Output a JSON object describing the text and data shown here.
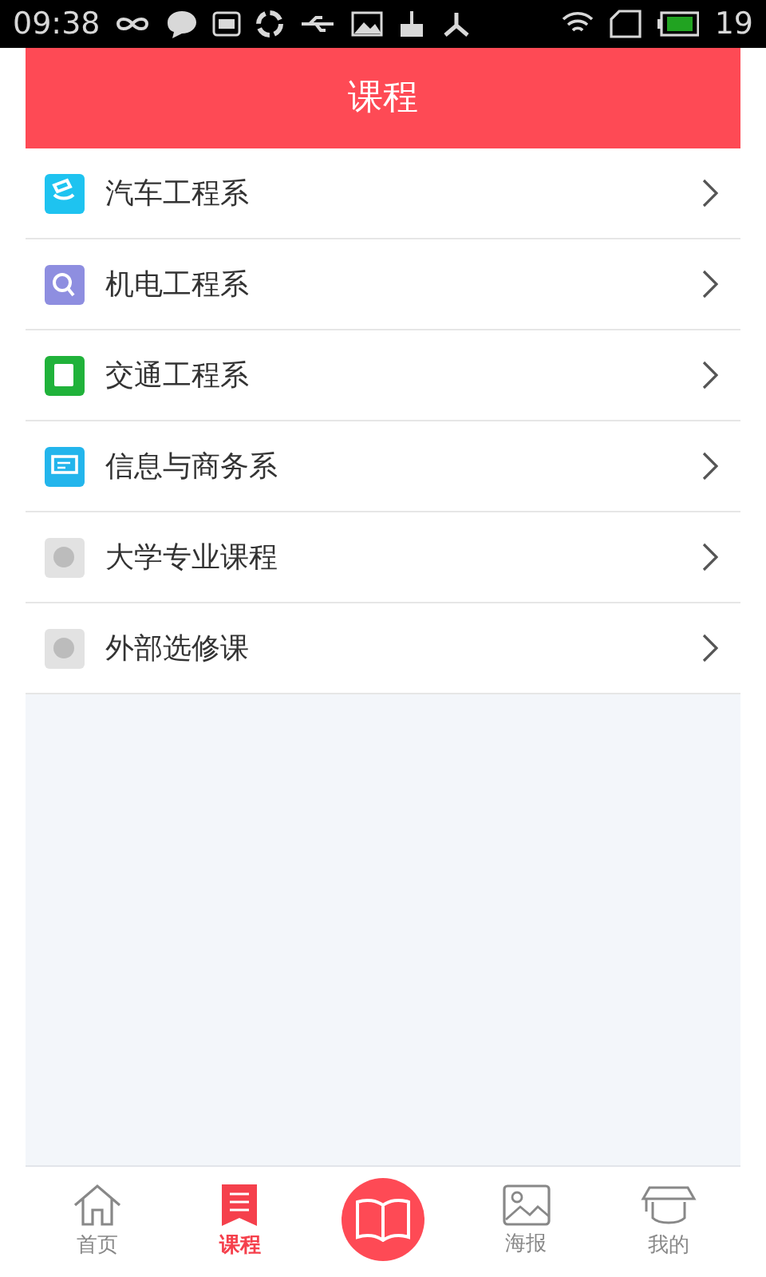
{
  "status_bar": {
    "time": "09:38",
    "battery": "19"
  },
  "header": {
    "title": "课程"
  },
  "courses": [
    {
      "label": "汽车工程系",
      "kind": "hand",
      "color": "#1ec3f0"
    },
    {
      "label": "机电工程系",
      "kind": "coin",
      "color": "#8e8ee0"
    },
    {
      "label": "交通工程系",
      "kind": "book",
      "color": "#20b23a"
    },
    {
      "label": "信息与商务系",
      "kind": "laptop",
      "color": "#23b5ec"
    },
    {
      "label": "大学专业课程",
      "kind": "disc",
      "color": "#e2e2e2"
    },
    {
      "label": "外部选修课",
      "kind": "disc",
      "color": "#e2e2e2"
    }
  ],
  "tabs": [
    {
      "kind": "home",
      "label": "首页",
      "selected": false
    },
    {
      "kind": "list",
      "label": "课程",
      "selected": true
    },
    {
      "kind": "center"
    },
    {
      "kind": "picture",
      "label": "海报",
      "selected": false
    },
    {
      "kind": "cap",
      "label": "我的",
      "selected": false
    }
  ]
}
